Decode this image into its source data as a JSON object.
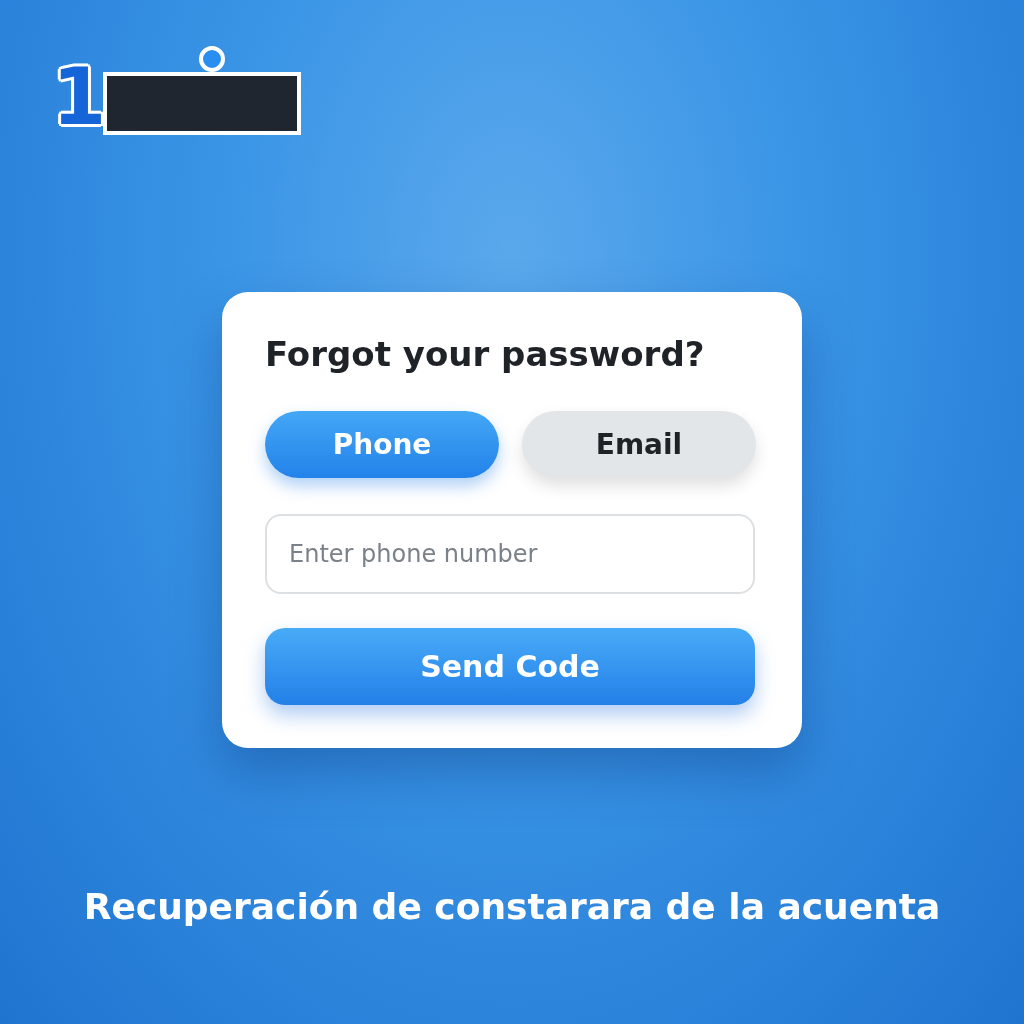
{
  "logo": {
    "mark": "1"
  },
  "card": {
    "title": "Forgot your password?",
    "tabs": [
      {
        "label": "Phone",
        "selected": true
      },
      {
        "label": "Email",
        "selected": false
      }
    ],
    "field": {
      "placeholder": "Enter phone number"
    },
    "button": "Send Code"
  },
  "caption": "Recuperación de constarara de la acuenta"
}
